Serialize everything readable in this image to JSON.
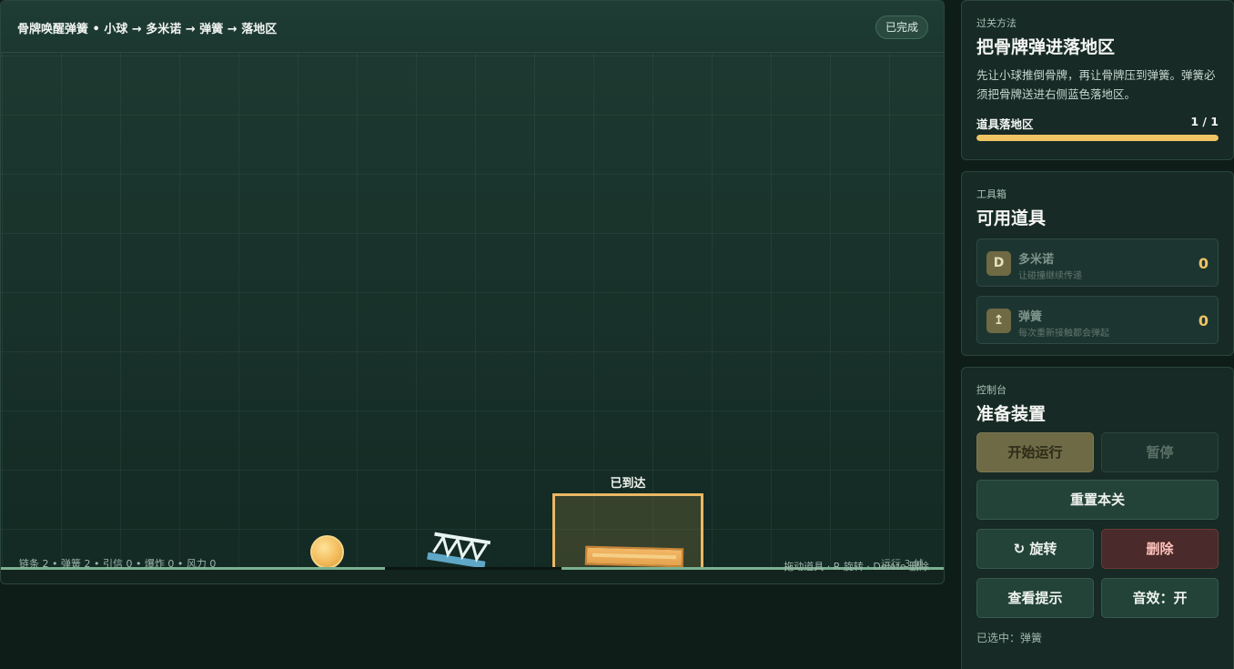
{
  "game": {
    "level_title": "骨牌唤醒弹簧 • 小球 → 多米诺 → 弹簧 → 落地区",
    "status": "已完成",
    "zone_label": "已到达",
    "stats": "链条 2 • 弹簧 2 • 引信 0 • 爆炸 0 • 风力 0",
    "hint": "拖动道具 · R 旋转 · Delete 删除",
    "run_overlay": "运行 3 帧"
  },
  "goal": {
    "eyebrow": "过关方法",
    "title": "把骨牌弹进落地区",
    "description": "先让小球推倒骨牌，再让骨牌压到弹簧。弹簧必须把骨牌送进右侧蓝色落地区。",
    "progress_label": "道具落地区",
    "progress_count": "1 / 1",
    "progress_fraction": 1.0
  },
  "toolbox": {
    "eyebrow": "工具箱",
    "title": "可用道具",
    "items": [
      {
        "icon": "D",
        "icon_name": "domino-icon",
        "name": "多米诺",
        "desc": "让碰撞继续传递",
        "count": "0"
      },
      {
        "icon": "↥",
        "icon_name": "spring-icon",
        "name": "弹簧",
        "desc": "每次重新接触都会弹起",
        "count": "0"
      }
    ]
  },
  "controls": {
    "eyebrow": "控制台",
    "title": "准备装置",
    "start": "开始运行",
    "pause": "暂停",
    "reset": "重置本关",
    "rotate": "↻ 旋转",
    "delete": "删除",
    "hint": "查看提示",
    "sound": "音效：开",
    "selected": "已选中：弹簧"
  },
  "colors": {
    "accent": "#f0c463",
    "ground": "#7bb08f",
    "danger": "#4a2a2a"
  }
}
